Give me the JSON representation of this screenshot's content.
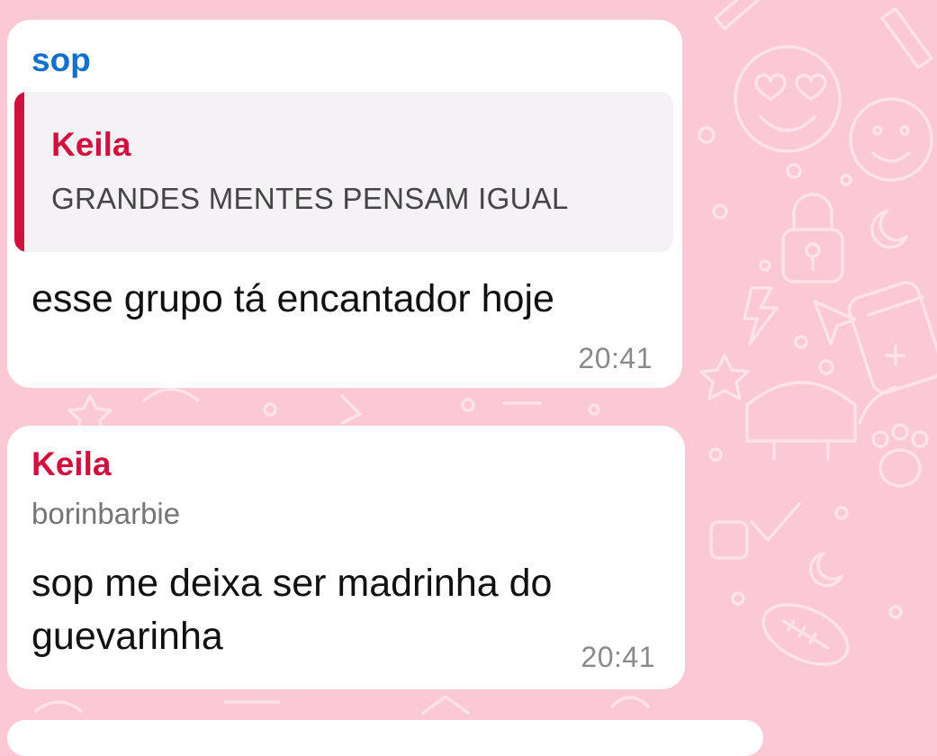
{
  "theme": {
    "wallpaper_color": "#fbc9d3",
    "doodle_color": "#fde3e9",
    "bubble_color": "#ffffff",
    "sop_color": "#1170c9",
    "keila_color": "#d0103e",
    "quote_background": "#f4f2f4"
  },
  "messages": [
    {
      "sender": "sop",
      "reply": {
        "author": "Keila",
        "text": "GRANDES MENTES PENSAM IGUAL"
      },
      "text": "esse grupo tá encantador hoje",
      "time": "20:41"
    },
    {
      "sender": "Keila",
      "username": "borinbarbie",
      "text": "sop me deixa ser madrinha do guevarinha",
      "time": "20:41"
    }
  ],
  "wallpaper_icons": [
    "heart-eyes-emoji-icon",
    "smiley-icon",
    "padlock-icon",
    "moon-icon",
    "cursor-icon",
    "calculator-icon",
    "football-icon",
    "cake-icon",
    "checkmark-icon",
    "star-icon",
    "paw-icon",
    "lightning-icon",
    "pencil-icon"
  ]
}
